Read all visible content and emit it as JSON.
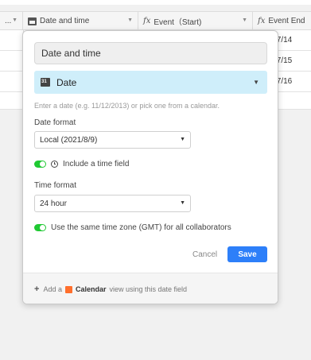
{
  "grid": {
    "columns": [
      {
        "label": "...",
        "type_icon": "none"
      },
      {
        "label": "Date and time",
        "type_icon": "calendar-icon"
      },
      {
        "label": "Event（Start)",
        "type_icon": "formula-icon"
      },
      {
        "label": "Event End",
        "type_icon": "formula-icon"
      }
    ],
    "rows": [
      {
        "event_end": "/7/14"
      },
      {
        "event_end": "/7/15"
      },
      {
        "event_end": "/7/16"
      },
      {
        "event_end": ""
      }
    ]
  },
  "popover": {
    "field_name": "Date and time",
    "field_type": "Date",
    "hint": "Enter a date (e.g. 11/12/2013) or pick one from a calendar.",
    "date_format_label": "Date format",
    "date_format_value": "Local (2021/8/9)",
    "include_time_label": "Include a time field",
    "include_time_on": true,
    "time_format_label": "Time format",
    "time_format_value": "24 hour",
    "gmt_label": "Use the same time zone (GMT) for all collaborators",
    "gmt_on": true,
    "cancel_label": "Cancel",
    "save_label": "Save",
    "footer": {
      "add_a": "Add a",
      "calendar": "Calendar",
      "rest": "view using this date field"
    }
  },
  "colors": {
    "accent": "#2d7ff9",
    "toggle_on": "#20c933",
    "type_select_bg": "#cfeefa",
    "calendar_icon": "#ff6f2c"
  }
}
